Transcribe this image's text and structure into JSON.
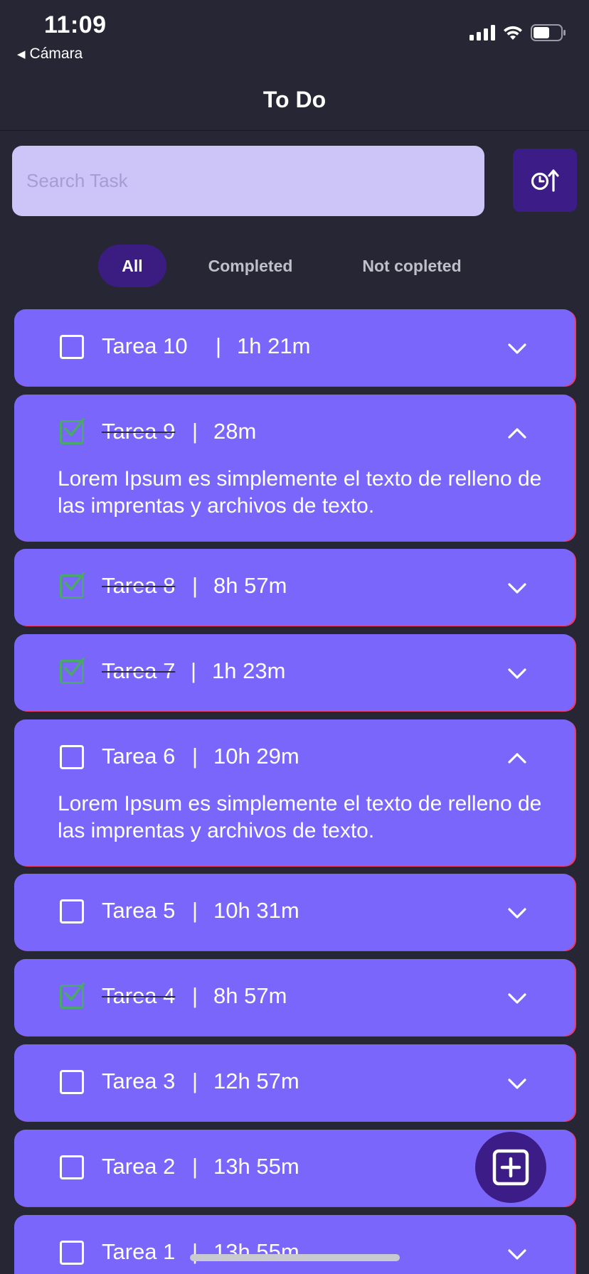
{
  "status_bar": {
    "time": "11:09",
    "back_app": "Cámara",
    "icons": [
      "signal-icon",
      "wifi-icon",
      "battery-icon"
    ]
  },
  "nav": {
    "title": "To Do"
  },
  "search": {
    "placeholder": "Search Task",
    "value": ""
  },
  "sort_button": {
    "icon": "clock-sort-up-icon"
  },
  "filters": {
    "selected": "All",
    "tabs": [
      {
        "label": "All"
      },
      {
        "label": "Completed"
      },
      {
        "label": "Not copleted"
      }
    ]
  },
  "tasks": [
    {
      "title": "Tarea 10",
      "separator": "|",
      "duration": "1h 21m",
      "completed": false,
      "expanded": false
    },
    {
      "title": "Tarea 9",
      "separator": "|",
      "duration": "28m",
      "completed": true,
      "expanded": true,
      "description": "Lorem Ipsum es simplemente el texto de relleno de las imprentas y archivos de texto."
    },
    {
      "title": "Tarea 8",
      "separator": "|",
      "duration": "8h 57m",
      "completed": true,
      "expanded": false
    },
    {
      "title": "Tarea 7",
      "separator": "|",
      "duration": "1h 23m",
      "completed": true,
      "expanded": false
    },
    {
      "title": "Tarea 6",
      "separator": "|",
      "duration": "10h 29m",
      "completed": false,
      "expanded": true,
      "description": "Lorem Ipsum es simplemente el texto de relleno de las imprentas y archivos de texto."
    },
    {
      "title": "Tarea 5",
      "separator": "|",
      "duration": "10h 31m",
      "completed": false,
      "expanded": false
    },
    {
      "title": "Tarea 4",
      "separator": "|",
      "duration": "8h 57m",
      "completed": true,
      "expanded": false
    },
    {
      "title": "Tarea 3",
      "separator": "|",
      "duration": "12h 57m",
      "completed": false,
      "expanded": false
    },
    {
      "title": "Tarea 2",
      "separator": "|",
      "duration": "13h 55m",
      "completed": false,
      "expanded": false
    },
    {
      "title": "Tarea 1",
      "separator": "|",
      "duration": "13h 55m",
      "completed": false,
      "expanded": false
    }
  ],
  "fab": {
    "icon": "add-square-icon"
  },
  "colors": {
    "background": "#272635",
    "card": "#7b66fc",
    "accent_dark": "#3c1c86",
    "search_bg": "#cdc5f8",
    "check_green": "#4aa86a"
  }
}
